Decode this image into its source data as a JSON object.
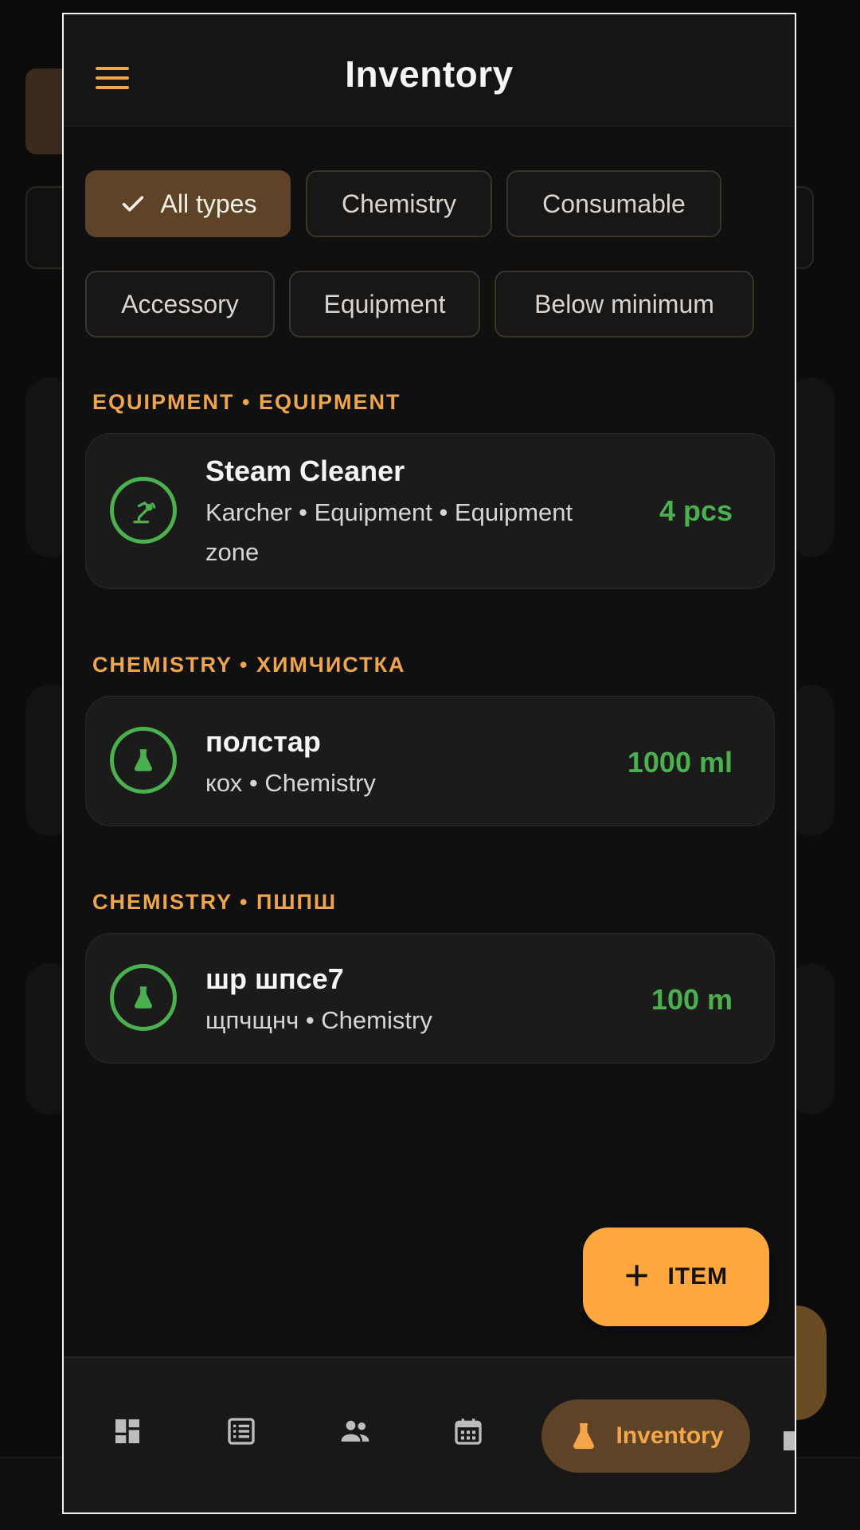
{
  "header": {
    "title": "Inventory"
  },
  "filters": [
    {
      "label": "All types",
      "selected": true
    },
    {
      "label": "Chemistry",
      "selected": false
    },
    {
      "label": "Consumable",
      "selected": false
    },
    {
      "label": "Accessory",
      "selected": false
    },
    {
      "label": "Equipment",
      "selected": false
    },
    {
      "label": "Below minimum",
      "selected": false
    }
  ],
  "sections": [
    {
      "label": "EQUIPMENT • EQUIPMENT",
      "item": {
        "name": "Steam Cleaner",
        "sub_line1": "Karcher • Equipment • Equipment",
        "sub_line2": "zone",
        "quantity": "4 pcs",
        "icon": "equipment-icon"
      }
    },
    {
      "label": "CHEMISTRY • ХИМЧИСТКА",
      "item": {
        "name": "полстар",
        "sub_line1": "кох • Chemistry",
        "quantity": "1000 ml",
        "icon": "flask-icon"
      }
    },
    {
      "label": "CHEMISTRY • ПШПШ",
      "item": {
        "name": "шр шпсе7",
        "sub_line1": "щпчщнч • Chemistry",
        "quantity": "100 m",
        "icon": "flask-icon"
      }
    }
  ],
  "fab": {
    "label": "ITEM",
    "icon": "plus-icon"
  },
  "bottom_nav": {
    "items": [
      "dashboard-icon",
      "list-icon",
      "people-icon",
      "calendar-icon"
    ],
    "active": {
      "label": "Inventory",
      "icon": "flask-icon"
    }
  },
  "colors": {
    "accent": "#f0a54d",
    "success": "#4caf50",
    "fab": "#ffa83f",
    "selected_chip": "#5e4426"
  }
}
